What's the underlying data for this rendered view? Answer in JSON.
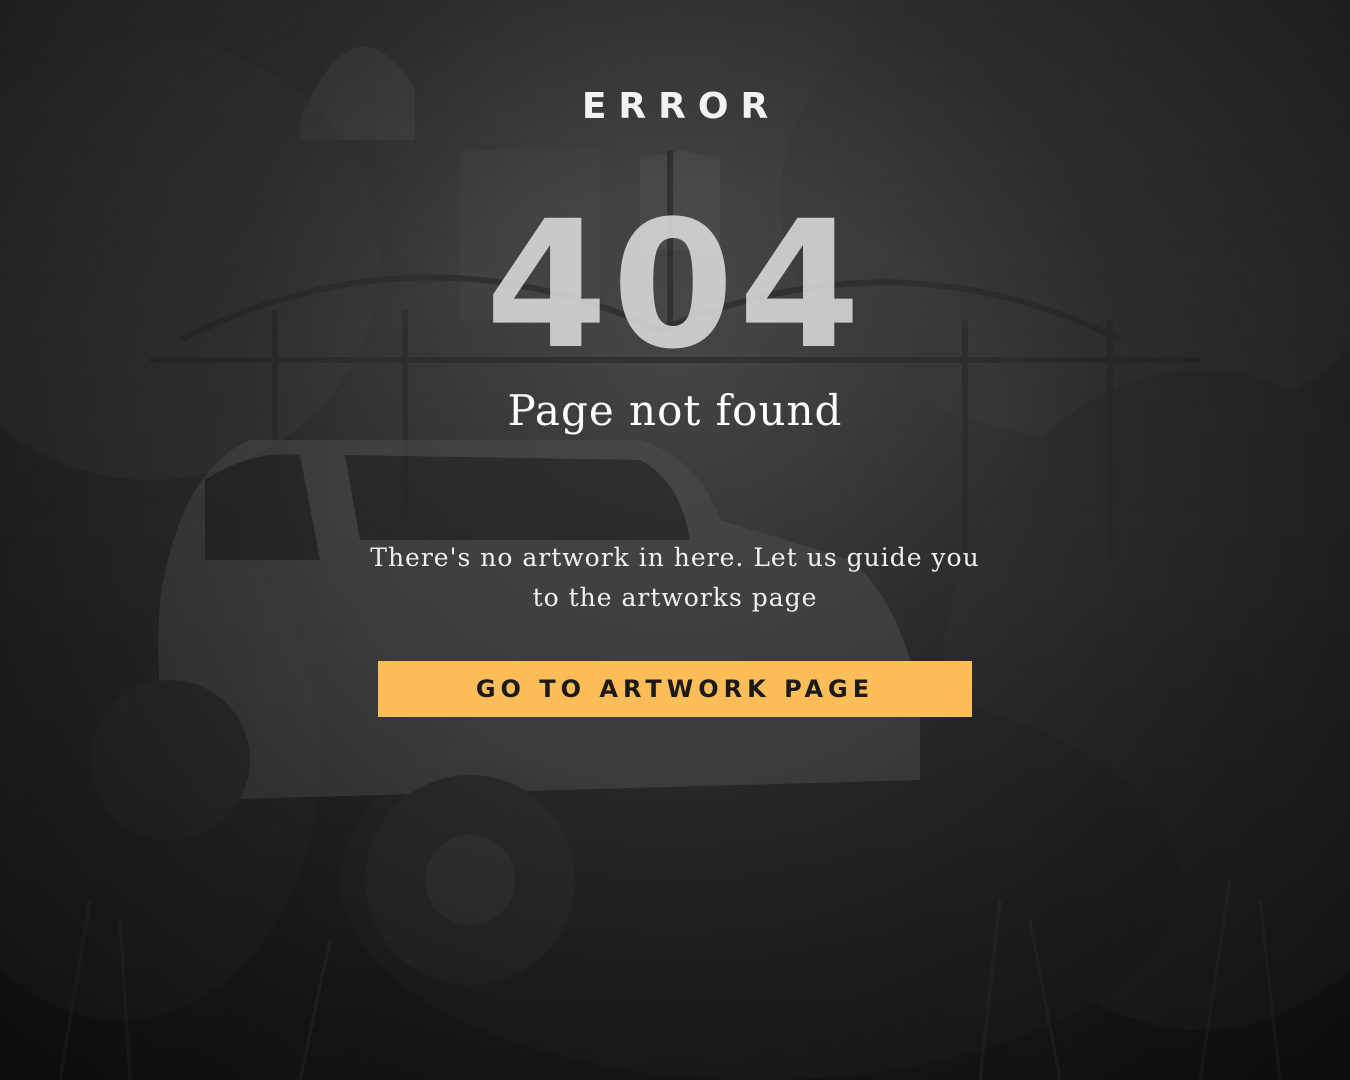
{
  "error_page": {
    "eyebrow": "ERROR",
    "code": "404",
    "title": "Page not found",
    "message": "There's no artwork in here. Let us guide you to the artworks page",
    "cta_label": "GO TO ARTWORK PAGE"
  },
  "colors": {
    "button_background": "#ffbd59",
    "button_text": "#1a1a1a",
    "text": "#ffffff",
    "background": "#2b2b2b"
  }
}
